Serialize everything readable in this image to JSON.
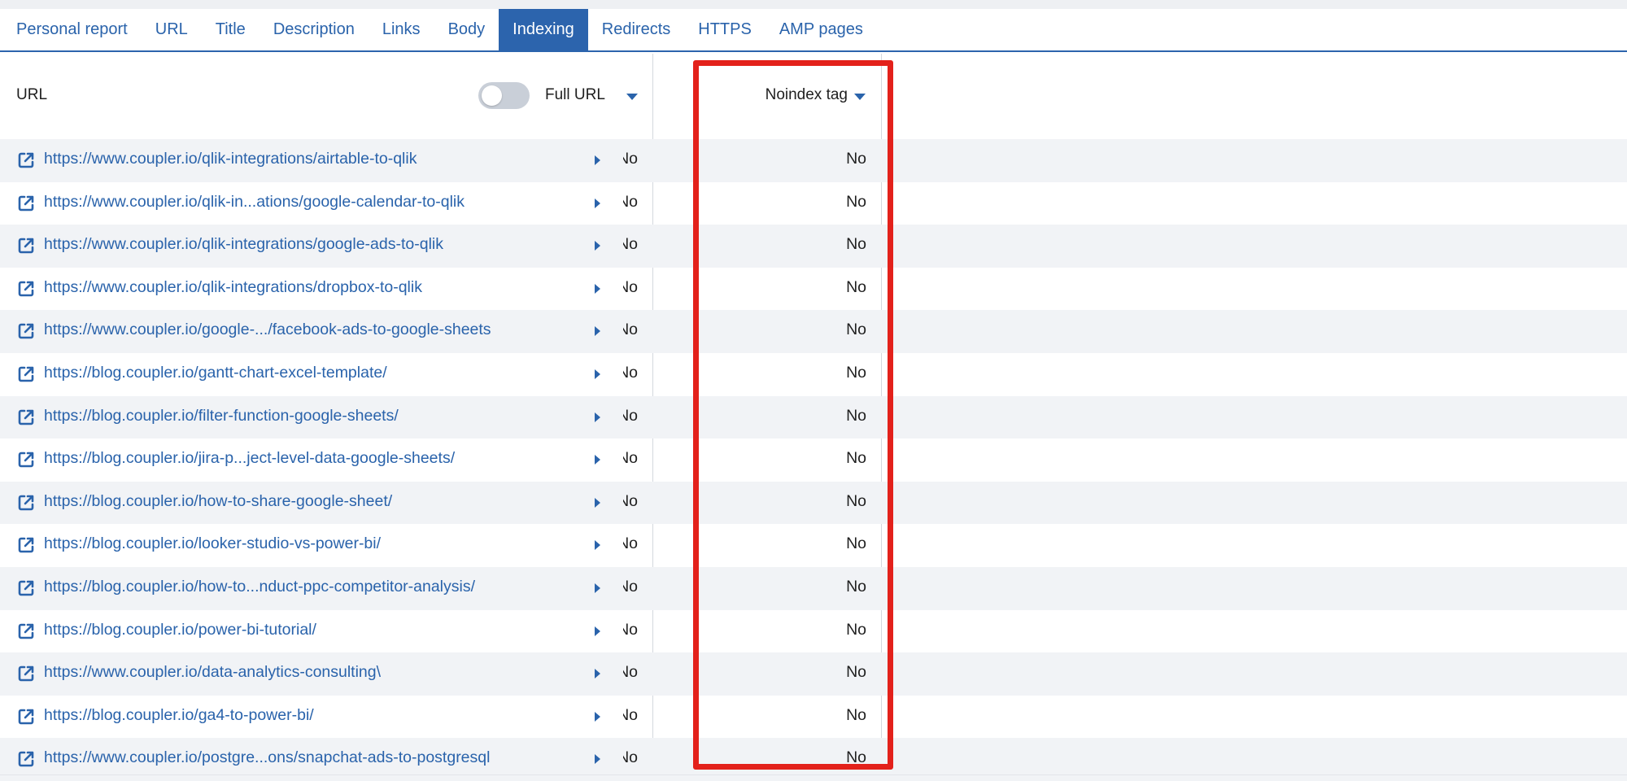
{
  "tabs": [
    {
      "label": "Personal report",
      "active": false
    },
    {
      "label": "URL",
      "active": false
    },
    {
      "label": "Title",
      "active": false
    },
    {
      "label": "Description",
      "active": false
    },
    {
      "label": "Links",
      "active": false
    },
    {
      "label": "Body",
      "active": false
    },
    {
      "label": "Indexing",
      "active": true
    },
    {
      "label": "Redirects",
      "active": false
    },
    {
      "label": "HTTPS",
      "active": false
    },
    {
      "label": "AMP pages",
      "active": false
    }
  ],
  "columns": {
    "url": "URL",
    "full_url_toggle_label": "Full URL",
    "full_url_toggle_on": false,
    "noindex": "Noindex tag"
  },
  "colors": {
    "accent": "#2c64ad",
    "highlight": "#e3211b"
  },
  "icons": {
    "row_link": "external-link-icon",
    "row_expand": "expand-arrow-icon",
    "sort": "caret-down-icon"
  },
  "rows": [
    {
      "url": "https://www.coupler.io/qlik-integrations/airtable-to-qlik",
      "hidden_col": "No",
      "noindex": "No"
    },
    {
      "url": "https://www.coupler.io/qlik-in...ations/google-calendar-to-qlik",
      "hidden_col": "No",
      "noindex": "No"
    },
    {
      "url": "https://www.coupler.io/qlik-integrations/google-ads-to-qlik",
      "hidden_col": "No",
      "noindex": "No"
    },
    {
      "url": "https://www.coupler.io/qlik-integrations/dropbox-to-qlik",
      "hidden_col": "No",
      "noindex": "No"
    },
    {
      "url": "https://www.coupler.io/google-.../facebook-ads-to-google-sheets",
      "hidden_col": "No",
      "noindex": "No"
    },
    {
      "url": "https://blog.coupler.io/gantt-chart-excel-template/",
      "hidden_col": "No",
      "noindex": "No"
    },
    {
      "url": "https://blog.coupler.io/filter-function-google-sheets/",
      "hidden_col": "No",
      "noindex": "No"
    },
    {
      "url": "https://blog.coupler.io/jira-p...ject-level-data-google-sheets/",
      "hidden_col": "No",
      "noindex": "No"
    },
    {
      "url": "https://blog.coupler.io/how-to-share-google-sheet/",
      "hidden_col": "No",
      "noindex": "No"
    },
    {
      "url": "https://blog.coupler.io/looker-studio-vs-power-bi/",
      "hidden_col": "No",
      "noindex": "No"
    },
    {
      "url": "https://blog.coupler.io/how-to...nduct-ppc-competitor-analysis/",
      "hidden_col": "No",
      "noindex": "No"
    },
    {
      "url": "https://blog.coupler.io/power-bi-tutorial/",
      "hidden_col": "No",
      "noindex": "No"
    },
    {
      "url": "https://www.coupler.io/data-analytics-consulting\\",
      "hidden_col": "No",
      "noindex": "No"
    },
    {
      "url": "https://blog.coupler.io/ga4-to-power-bi/",
      "hidden_col": "No",
      "noindex": "No"
    },
    {
      "url": "https://www.coupler.io/postgre...ons/snapchat-ads-to-postgresql",
      "hidden_col": "No",
      "noindex": "No"
    }
  ]
}
